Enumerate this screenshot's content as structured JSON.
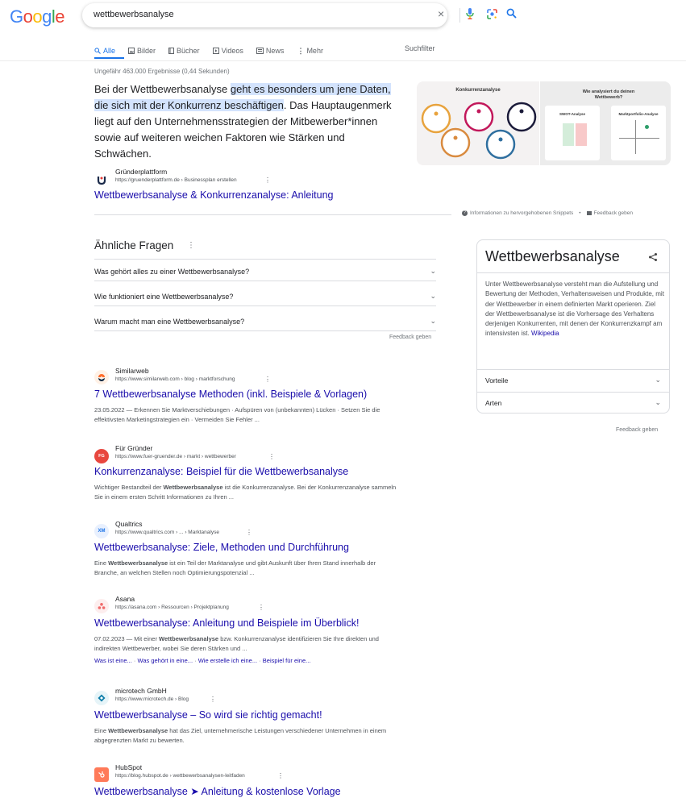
{
  "logo": {
    "letters": [
      "G",
      "o",
      "o",
      "g",
      "l",
      "e"
    ],
    "colors": [
      "#4285f4",
      "#ea4335",
      "#fbbc05",
      "#4285f4",
      "#34a853",
      "#ea4335"
    ]
  },
  "search": {
    "query": "wettbewerbsanalyse"
  },
  "tabs": [
    {
      "label": "Alle",
      "icon": "search-icon"
    },
    {
      "label": "Bilder",
      "icon": "image-icon"
    },
    {
      "label": "Bücher",
      "icon": "book-icon"
    },
    {
      "label": "Videos",
      "icon": "video-icon"
    },
    {
      "label": "News",
      "icon": "news-icon"
    },
    {
      "label": "Mehr",
      "icon": "more-icon"
    }
  ],
  "filter_label": "Suchfilter",
  "stats": "Ungefähr 463.000 Ergebnisse (0,44 Sekunden)",
  "snippet": {
    "pre": "Bei der Wettbewerbsanalyse ",
    "highlight": "geht es besonders um jene Daten, die sich mit der Konkurrenz beschäftigen",
    "post": ". Das Hauptaugenmerk liegt auf den Unternehmensstrategien der Mitbewerber*innen sowie auf weiteren weichen Faktoren wie Stärken und Schwächen.",
    "source_name": "Gründerplattform",
    "source_url": "https://gruenderplattform.de › Businessplan erstellen",
    "title": "Wettbewerbsanalyse & Konkurrenzanalyse: Anleitung",
    "img1_title": "Konkurrenzanalyse",
    "img2_title": "Wie analysiert du deinen Wettbewerb?",
    "img2_sub_left": "SWOT-Analyse",
    "img2_sub_right": "Marktportfolio-Analyse",
    "about": "Informationen zu hervorgehobenen Snippets",
    "feedback": "Feedback geben"
  },
  "paa": {
    "title": "Ähnliche Fragen",
    "questions": [
      "Was gehört alles zu einer Wettbewerbsanalyse?",
      "Wie funktioniert eine Wettbewerbsanalyse?",
      "Warum macht man eine Wettbewerbsanalyse?"
    ],
    "feedback": "Feedback geben"
  },
  "knowledge": {
    "title": "Wettbewerbsanalyse",
    "desc": "Unter Wettbewerbsanalyse versteht man die Aufstellung und Bewertung der Methoden, Verhaltensweisen und Produkte, mit der Wettbewerber in einem definierten Markt operieren. Ziel der Wettbewerbsanalyse ist die Vorhersage des Verhaltens derjenigen Konkurrenten, mit denen der Konkurrenzkampf am intensivsten ist.",
    "source": "Wikipedia",
    "rows": [
      "Vorteile",
      "Arten"
    ],
    "feedback": "Feedback geben"
  },
  "results": [
    {
      "name": "Similarweb",
      "url": "https://www.similarweb.com › blog › marktforschung",
      "title": "7 Wettbewerbsanalyse Methoden (inkl. Beispiele & Vorlagen)",
      "desc": "23.05.2022 — Erkennen Sie Marktverschiebungen · Aufspüren von (unbekannten) Lücken · Setzen Sie die effektivsten Marketingstrategien ein · Vermeiden Sie Fehler ...",
      "logo": "◖",
      "logo_color": "#092540",
      "logo_bg": "#fff1e6"
    },
    {
      "name": "Für Gründer",
      "url": "https://www.fuer-gruender.de › markt › wettbewerber",
      "title": "Konkurrenzanalyse: Beispiel für die Wettbewerbsanalyse",
      "desc_pre": "Wichtiger Bestandteil der ",
      "desc_bold": "Wettbewerbsanalyse",
      "desc_post": " ist die Konkurrenzanalyse. Bei der Konkurrenzanalyse sammeln Sie in einem ersten Schritt Informationen zu Ihren ...",
      "logo": "FG",
      "logo_color": "#ffffff",
      "logo_bg": "#e8473f"
    },
    {
      "name": "Qualtrics",
      "url": "https://www.qualtrics.com › ... › Marktanalyse",
      "title": "Wettbewerbsanalyse: Ziele, Methoden und Durchführung",
      "desc_pre": "Eine ",
      "desc_bold": "Wettbewerbsanalyse",
      "desc_post": " ist ein Teil der Marktanalyse und gibt Auskunft über Ihren Stand innerhalb der Branche, an welchen Stellen noch Optimierungspotenzial ...",
      "logo": "XM",
      "logo_color": "#1a73e8",
      "logo_bg": "#e8f0fe"
    },
    {
      "name": "Asana",
      "url": "https://asana.com › Ressourcen › Projektplanung",
      "title": "Wettbewerbsanalyse: Anleitung und Beispiele im Überblick!",
      "desc_pre": "07.02.2023 — Mit einer ",
      "desc_bold": "Wettbewerbsanalyse",
      "desc_post": " bzw. Konkurrenzanalyse identifizieren Sie Ihre direkten und indirekten Wettbewerber, wobei Sie deren Stärken und ...",
      "sitelinks": [
        "Was ist eine...",
        "Was gehört in eine...",
        "Wie erstelle ich eine...",
        "Beispiel für eine..."
      ],
      "logo": "⁂",
      "logo_color": "#f06a6a",
      "logo_bg": "#fdeeee"
    },
    {
      "name": "microtech GmbH",
      "url": "https://www.microtech.de › Blog",
      "title": "Wettbewerbsanalyse – So wird sie richtig gemacht!",
      "desc_pre": "Eine ",
      "desc_bold": "Wettbewerbsanalyse",
      "desc_post": " hat das Ziel, unternehmerische Leistungen verschiedener Unternehmen in einem abgegrenzten Markt zu bewerten.",
      "logo": "◆",
      "logo_color": "#0a7ca8",
      "logo_bg": "#e6f4f8"
    },
    {
      "name": "HubSpot",
      "url": "https://blog.hubspot.de › wettbewerbsanalysen-leitfaden",
      "title": "Wettbewerbsanalyse ➤ Anleitung & kostenlose Vorlage",
      "logo": "✺",
      "logo_color": "#ffffff",
      "logo_bg": "#ff7a59"
    }
  ]
}
